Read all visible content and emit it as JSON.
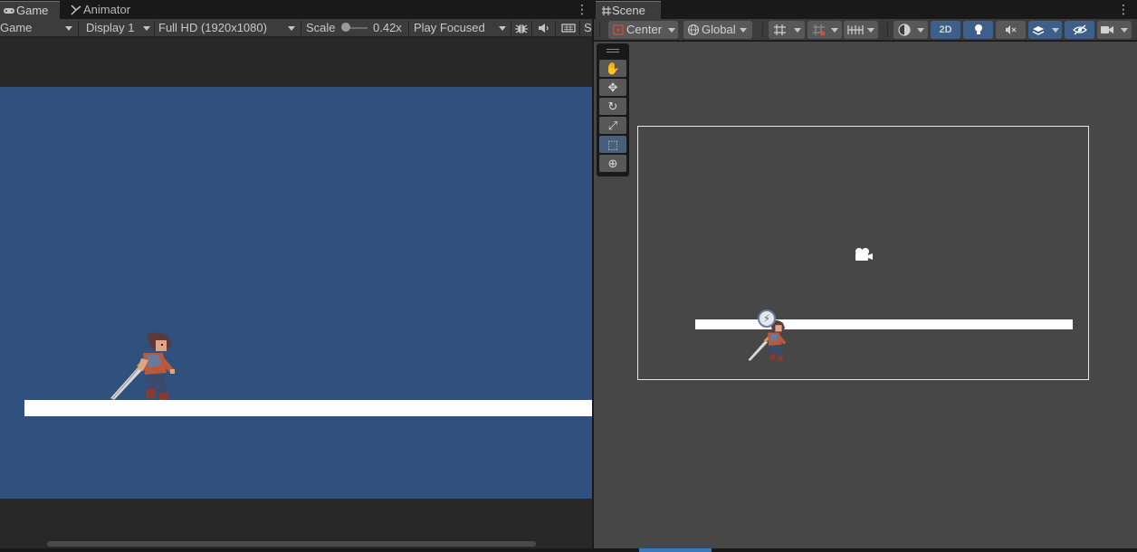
{
  "game_tabs": [
    {
      "label": "Game",
      "icon": "gamepad-icon"
    },
    {
      "label": "Animator",
      "icon": "animator-icon"
    }
  ],
  "game_toolbar": {
    "view_mode": "Game",
    "display": "Display 1",
    "resolution": "Full HD (1920x1080)",
    "scale_label": "Scale",
    "scale_value": "0.42x",
    "play_mode": "Play Focused",
    "truncated": "S"
  },
  "scene_tabs": [
    {
      "label": "Scene",
      "icon": "grid-icon"
    }
  ],
  "scene_toolbar": {
    "pivot_mode": "Center",
    "pivot_rotation": "Global",
    "mode_2d": "2D"
  },
  "tool_palette": [
    {
      "name": "hand-tool",
      "glyph": "✋",
      "active": false
    },
    {
      "name": "move-tool",
      "glyph": "✥",
      "active": false
    },
    {
      "name": "rotate-tool",
      "glyph": "↻",
      "active": false
    },
    {
      "name": "scale-tool",
      "glyph": "⤢",
      "active": false
    },
    {
      "name": "rect-tool",
      "glyph": "⬚",
      "active": true
    },
    {
      "name": "transform-tool",
      "glyph": "⊕",
      "active": false
    }
  ],
  "colors": {
    "accent": "#3a79bb",
    "game_background": "#30507d",
    "scene_background": "#474747",
    "editor_background": "#282828",
    "toggle_on": "#3e5f8a"
  }
}
